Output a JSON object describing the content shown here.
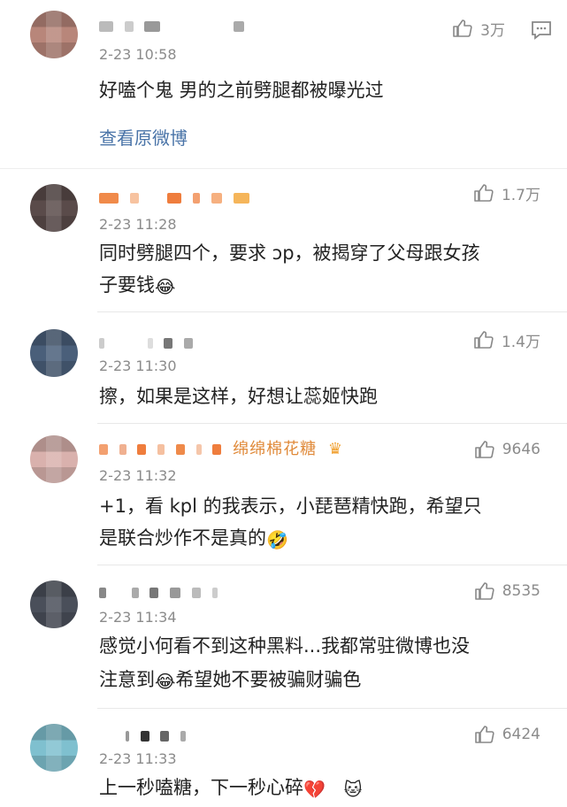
{
  "comments": [
    {
      "time": "2-23 10:58",
      "likes": "3万",
      "text": [
        "好嗑个鬼 男的之前劈腿都被曝光过"
      ],
      "link": "查看原微博"
    },
    {
      "time": "2-23 11:28",
      "likes": "1.7万",
      "text": [
        "同时劈腿四个，要求 ɔp，被揭穿了父母跟女孩",
        "子要钱"
      ],
      "emoji": "😂"
    },
    {
      "time": "2-23 11:30",
      "likes": "1.4万",
      "text": [
        "擦，如果是这样，好想让蕊姬快跑"
      ]
    },
    {
      "name_suffix": "绵绵棉花糖",
      "time": "2-23 11:32",
      "likes": "9646",
      "text": [
        "+1，看 kpl 的我表示，小琵琶精快跑，希望只",
        "是联合炒作不是真的"
      ],
      "emoji": "🤣"
    },
    {
      "time": "2-23 11:34",
      "likes": "8535",
      "text": [
        "感觉小何看不到这种黑料...我都常驻微博也没",
        "注意到"
      ],
      "text2_tail": "希望她不要被骗财骗色",
      "emoji": "😂"
    },
    {
      "time": "2-23 11:33",
      "likes": "6424",
      "text": [
        "上一秒嗑糖，下一秒心碎"
      ],
      "emoji1": "💔",
      "emoji2": "🐱"
    }
  ],
  "colors": {
    "accent_link": "#4a74a8",
    "meta_gray": "#8b8b8b",
    "name_suffix": "#e08a3a"
  },
  "icons": {
    "like": "thumb-up-icon",
    "reply": "comment-bubble-icon",
    "crown": "crown-badge-icon"
  }
}
